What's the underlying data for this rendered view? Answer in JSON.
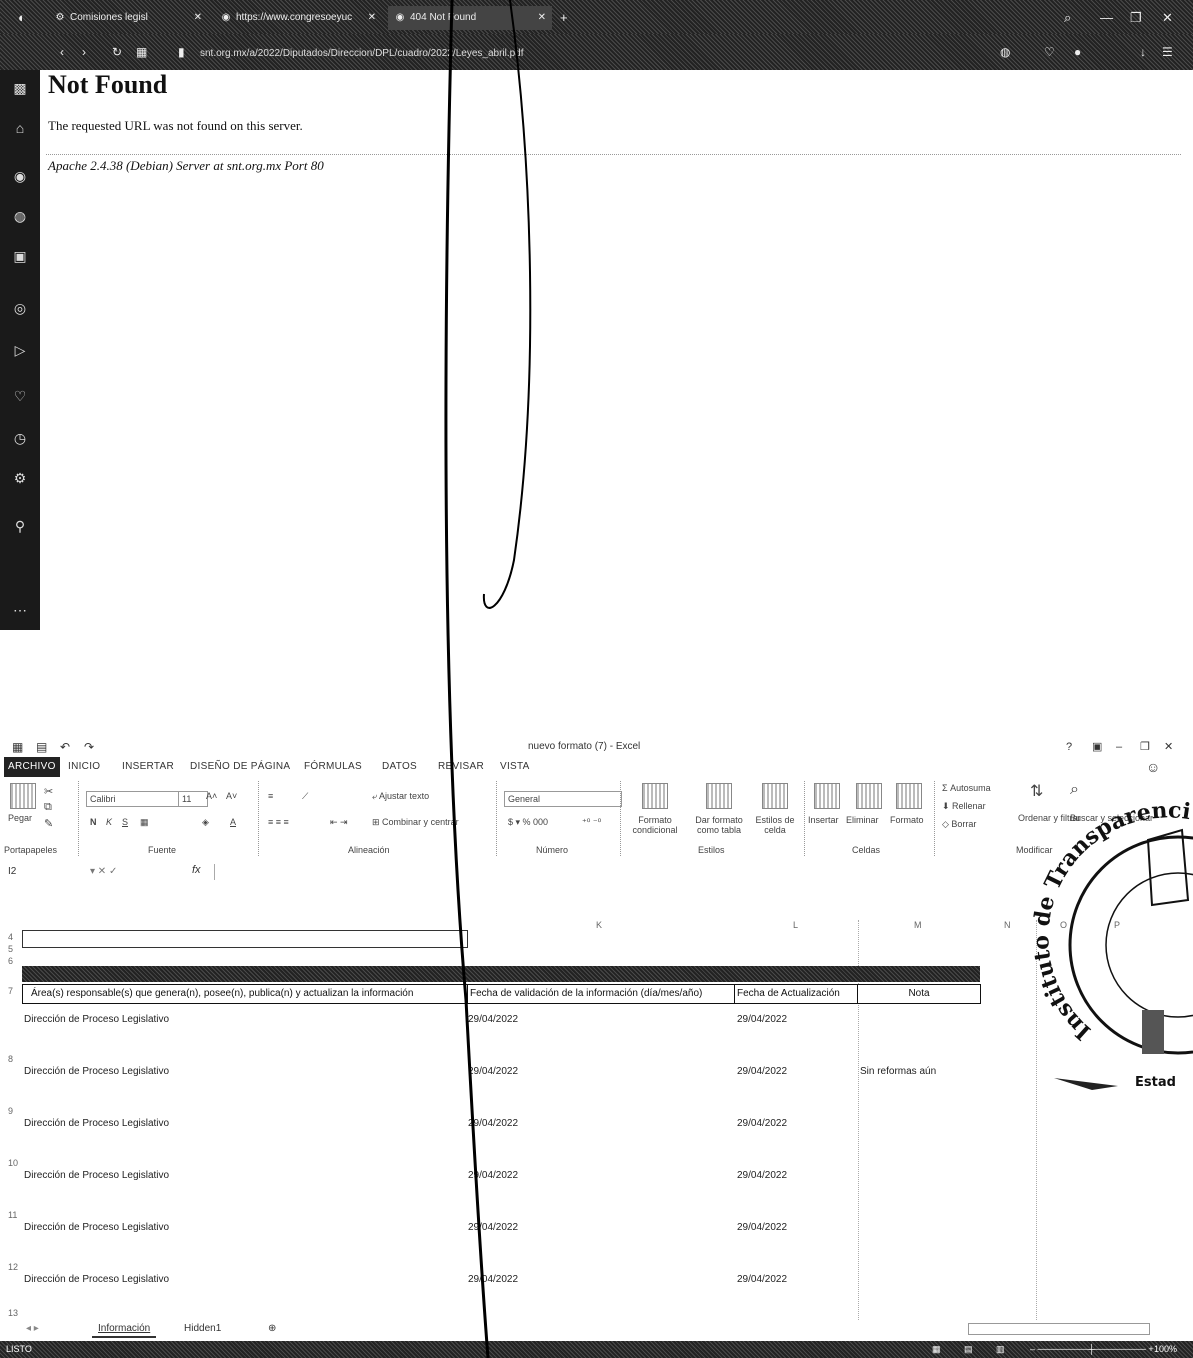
{
  "browser": {
    "tabs": [
      {
        "label": "Comisiones legisl",
        "icon": "gear-icon"
      },
      {
        "label": "https://www.congresoeyuc",
        "icon": "globe-icon"
      },
      {
        "label": "404 Not Found",
        "icon": "globe-icon"
      }
    ],
    "new_tab": "+",
    "url": "snt.org.mx/a/2022/Diputados/Direccion/DPL/cuadro/2022/Leyes_abril.pdf",
    "page": {
      "title": "Not Found",
      "message": "The requested URL was not found on this server.",
      "address": "Apache 2.4.38 (Debian) Server at snt.org.mx Port 80"
    }
  },
  "excel": {
    "title": "nuevo formato (7) - Excel",
    "menu": [
      "ARCHIVO",
      "INICIO",
      "INSERTAR",
      "DISEÑO DE PÁGINA",
      "FÓRMULAS",
      "DATOS",
      "REVISAR",
      "VISTA"
    ],
    "ribbon": {
      "paste": "Pegar",
      "font": "Calibri",
      "font_size": "11",
      "wrap": "Ajustar texto",
      "merge": "Combinar y centrar",
      "number_format": "General",
      "conditional": "Formato condicional",
      "as_table": "Dar formato como tabla",
      "cell_styles": "Estilos de celda",
      "insert": "Insertar",
      "delete": "Eliminar",
      "format": "Formato",
      "autosum": "Autosuma",
      "fill": "Rellenar",
      "clear": "Borrar",
      "sort": "Ordenar y filtrar",
      "find": "Buscar y seleccionar",
      "groups": [
        "Portapapeles",
        "Fuente",
        "Alineación",
        "Número",
        "Estilos",
        "Celdas",
        "Modificar"
      ]
    },
    "namebox": "I2",
    "columns": [
      "K",
      "L",
      "M",
      "N",
      "O",
      "P"
    ],
    "rows": [
      "4",
      "5",
      "6",
      "7",
      "8",
      "9",
      "10",
      "11",
      "12",
      "13"
    ],
    "headers": [
      "Área(s) responsable(s) que genera(n), posee(n), publica(n) y actualizan la información",
      "Fecha de validación de la información (día/mes/año)",
      "Fecha de Actualización",
      "Nota"
    ],
    "data": [
      {
        "area": "Dirección de Proceso Legislativo",
        "validacion": "29/04/2022",
        "actualizacion": "29/04/2022",
        "nota": ""
      },
      {
        "area": "Dirección de Proceso Legislativo",
        "validacion": "29/04/2022",
        "actualizacion": "29/04/2022",
        "nota": "Sin reformas aún"
      },
      {
        "area": "Dirección de Proceso Legislativo",
        "validacion": "29/04/2022",
        "actualizacion": "29/04/2022",
        "nota": ""
      },
      {
        "area": "Dirección de Proceso Legislativo",
        "validacion": "29/04/2022",
        "actualizacion": "29/04/2022",
        "nota": ""
      },
      {
        "area": "Dirección de Proceso Legislativo",
        "validacion": "29/04/2022",
        "actualizacion": "29/04/2022",
        "nota": ""
      },
      {
        "area": "Dirección de Proceso Legislativo",
        "validacion": "29/04/2022",
        "actualizacion": "29/04/2022",
        "nota": ""
      }
    ],
    "sheets": [
      "Información",
      "Hidden1"
    ],
    "status": "LISTO",
    "zoom": "100%"
  },
  "stamp": {
    "text": "Instituto de Transparencia y Ac",
    "footer": "Estad"
  }
}
